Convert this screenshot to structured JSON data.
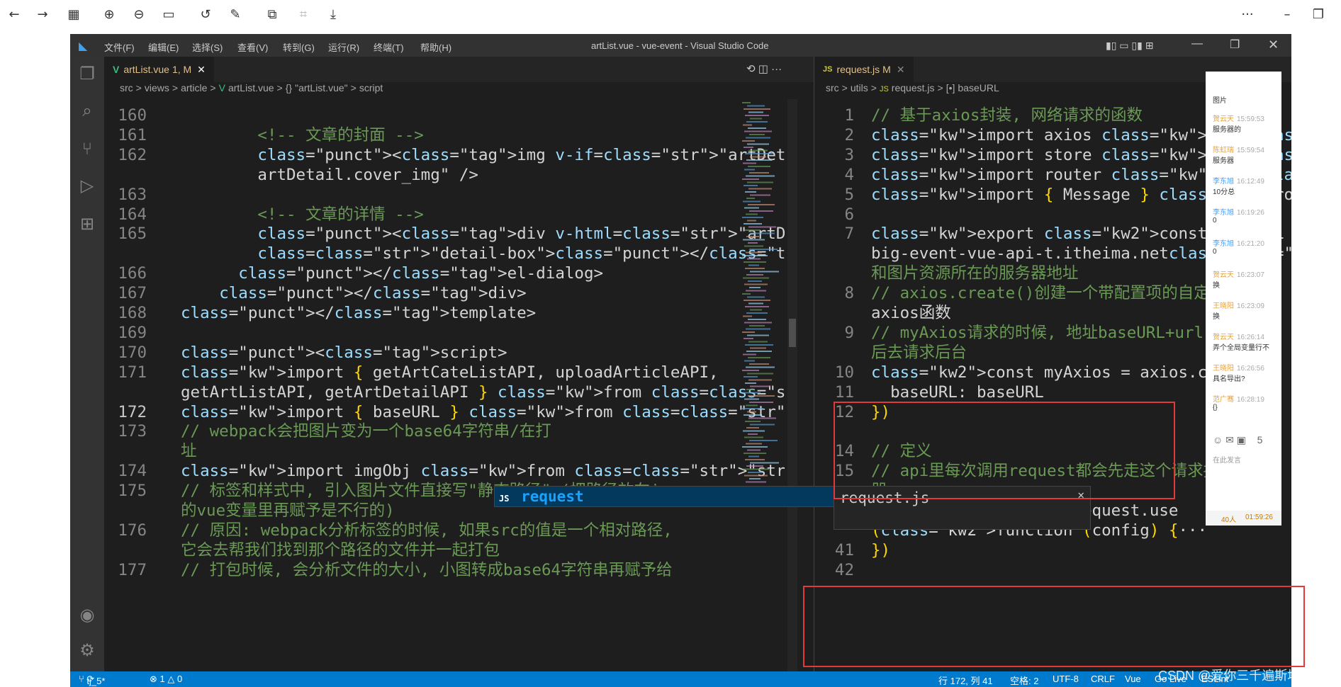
{
  "viewer": {
    "icons": [
      "back-icon",
      "forward-icon",
      "grid-icon",
      "zoom-in-icon",
      "zoom-out-icon",
      "fit-icon",
      "rotate-icon",
      "edit-icon",
      "copy-icon",
      "crop-icon",
      "download-icon",
      "more-icon",
      "minimize-icon",
      "restore-icon"
    ]
  },
  "titlebar": {
    "menus": [
      "文件(F)",
      "编辑(E)",
      "选择(S)",
      "查看(V)",
      "转到(G)",
      "运行(R)",
      "终端(T)",
      "帮助(H)"
    ],
    "title": "artList.vue - vue-event - Visual Studio Code"
  },
  "left": {
    "tab_label": "artList.vue",
    "tab_badge": "1, M",
    "breadcrumb": [
      "src",
      ">",
      "views",
      ">",
      "article",
      ">",
      "V",
      "artList.vue",
      ">",
      "{}",
      "\"artList.vue\"",
      ">",
      "script"
    ],
    "lines": [
      {
        "n": "160",
        "code": ""
      },
      {
        "n": "161",
        "code": "        <!-- 文章的封面 -->"
      },
      {
        "n": "162",
        "code": "        <img v-if=\"artDetail.cover_img\" alt=\"\" :src=\" +"
      },
      {
        "n": "",
        "code": "        artDetail.cover_img\" />"
      },
      {
        "n": "163",
        "code": ""
      },
      {
        "n": "164",
        "code": "        <!-- 文章的详情 -->"
      },
      {
        "n": "165",
        "code": "        <div v-html=\"artDetail.content\""
      },
      {
        "n": "",
        "code": "        class=\"detail-box\"></div>"
      },
      {
        "n": "166",
        "code": "      </el-dialog>"
      },
      {
        "n": "167",
        "code": "    </div>"
      },
      {
        "n": "168",
        "code": "</template>"
      },
      {
        "n": "169",
        "code": ""
      },
      {
        "n": "170",
        "code": "<script>"
      },
      {
        "n": "171",
        "code": "import { getArtCateListAPI, uploadArticleAPI,"
      },
      {
        "n": "",
        "code": "getArtListAPI, getArtDetailAPI } from '@/api'"
      },
      {
        "n": "172",
        "code": "import { baseURL } from '@/utils/request'"
      },
      {
        "n": "173",
        "code": "// webpack会把图片变为一个base64字符串/在打"
      },
      {
        "n": "",
        "code": "址"
      },
      {
        "n": "174",
        "code": "import imgObj from '../../assets/images/cover.jpg'"
      },
      {
        "n": "175",
        "code": "// 标签和样式中, 引入图片文件直接写\"静态路径\" (把路径放在js"
      },
      {
        "n": "",
        "code": "的vue变量里再赋予是不行的)"
      },
      {
        "n": "176",
        "code": "// 原因: webpack分析标签的时候, 如果src的值是一个相对路径,"
      },
      {
        "n": "",
        "code": "它会去帮我们找到那个路径的文件并一起打包"
      },
      {
        "n": "177",
        "code": "// 打包时候, 会分析文件的大小, 小图转成base64字符串再赋予给"
      }
    ]
  },
  "right": {
    "tab_label": "request.js",
    "tab_badge": "M",
    "breadcrumb": [
      "src",
      ">",
      "utils",
      ">",
      "JS",
      "request.js",
      ">",
      "[•]",
      "baseURL"
    ],
    "lines": [
      {
        "n": "1",
        "code": "// 基于axios封装, 网络请求的函数"
      },
      {
        "n": "2",
        "code": "import axios from 'axios'"
      },
      {
        "n": "3",
        "code": "import store from '@/store'"
      },
      {
        "n": "4",
        "code": "import router from '@/router'"
      },
      {
        "n": "5",
        "code": "import { Message } from 'element-ui'"
      },
      {
        "n": "6",
        "code": ""
      },
      {
        "n": "7",
        "code": "export const baseURL = 'http://"
      },
      {
        "n": "",
        "code": "big-event-vue-api-t.itheima.net' // 接"
      },
      {
        "n": "",
        "code": "和图片资源所在的服务器地址"
      },
      {
        "n": "8",
        "code": "// axios.create()创建一个带配置项的自定义"
      },
      {
        "n": "",
        "code": "axios函数"
      },
      {
        "n": "9",
        "code": "// myAxios请求的时候, 地址baseURL+url,"
      },
      {
        "n": "",
        "code": "后去请求后台"
      },
      {
        "n": "10",
        "code": "const myAxios = axios.create({"
      },
      {
        "n": "11",
        "code": "  baseURL: baseURL"
      },
      {
        "n": "12",
        "code": "})"
      },
      {
        "n": "",
        "code": ""
      },
      {
        "n": "14",
        "code": "// 定义"
      },
      {
        "n": "15",
        "code": "// api里每次调用request都会先走这个请求拦截"
      },
      {
        "n": "",
        "code": "器"
      },
      {
        "n": "16",
        "code": "myAxios.interceptors.request.use"
      },
      {
        "n": "",
        "code": "(function (config) {···"
      },
      {
        "n": "41",
        "code": "})"
      },
      {
        "n": "42",
        "code": ""
      }
    ]
  },
  "suggest": {
    "item": "request",
    "detail": "request.js",
    "icon": "JS"
  },
  "chat": {
    "header": "图片",
    "items": [
      {
        "name": "贺云天",
        "time": "15:59:53",
        "text": "服务器的"
      },
      {
        "name": "陈虹瑞",
        "time": "15:59:54",
        "text": "服务器"
      },
      {
        "name": "李东旭",
        "time": "16:12:49",
        "text": "10分总"
      },
      {
        "name": "李东旭",
        "time": "16:19:26",
        "text": "0"
      },
      {
        "name": "李东旭",
        "time": "16:21:20",
        "text": "0"
      },
      {
        "name": "贺云天",
        "time": "16:23:07",
        "text": "换"
      },
      {
        "name": "王晓阳",
        "time": "16:23:09",
        "text": "换"
      },
      {
        "name": "贺云天",
        "time": "16:26:14",
        "text": "弄个全局变量行不"
      },
      {
        "name": "王晓阳",
        "time": "16:26:56",
        "text": "具名导出?"
      },
      {
        "name": "范广骞",
        "time": "16:28:19",
        "text": "{}"
      }
    ],
    "input_placeholder": "在此发言",
    "footer_count": "40人",
    "footer_time": "01:59:26"
  },
  "status": {
    "branch": "tj_5*",
    "problems": "⊗ 1 △ 0",
    "position": "行 172, 列 41",
    "spaces": "空格: 2",
    "encoding": "UTF-8",
    "eol": "CRLF",
    "lang": "Vue",
    "golive": "Go Live",
    "eslint": "ESLint"
  },
  "watermark": "CSDN @爱你三千遍斯塔克",
  "colors": {
    "editor_bg": "#1e1e1e",
    "statusbar": "#007acc",
    "highlight_box": "#e23a3a"
  }
}
